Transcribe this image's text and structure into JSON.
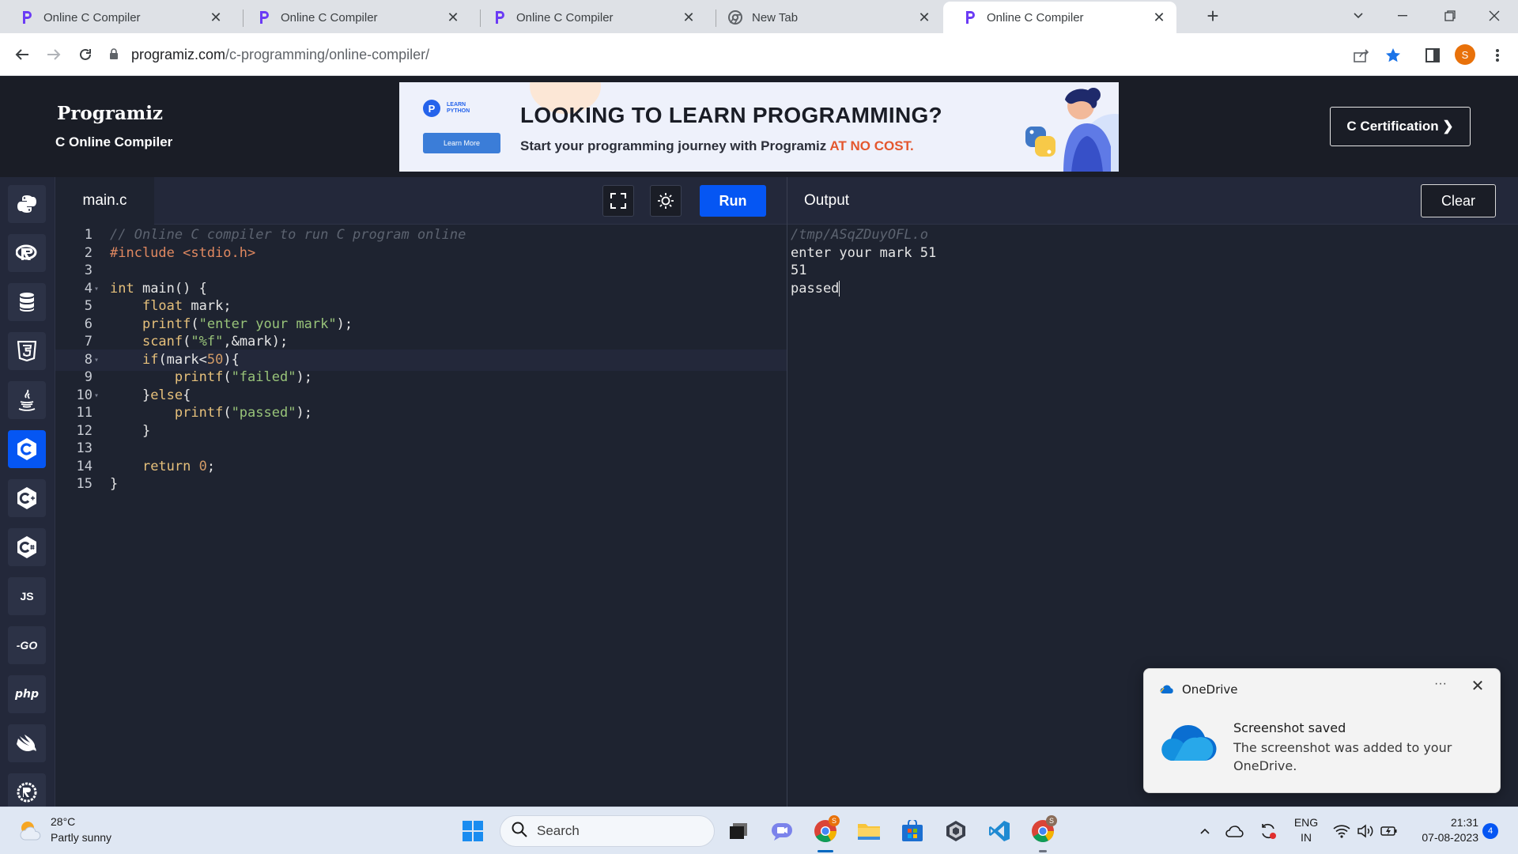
{
  "browser": {
    "tabs": [
      {
        "title": "Online C Compiler",
        "favicon": "programiz-icon",
        "active": false
      },
      {
        "title": "Online C Compiler",
        "favicon": "programiz-icon",
        "active": false
      },
      {
        "title": "Online C Compiler",
        "favicon": "programiz-icon",
        "active": false
      },
      {
        "title": "New Tab",
        "favicon": "chrome-icon",
        "active": false
      },
      {
        "title": "Online C Compiler",
        "favicon": "programiz-icon",
        "active": true
      }
    ],
    "url_domain": "programiz.com",
    "url_path": "/c-programming/online-compiler/",
    "profile_initial": "S"
  },
  "site": {
    "logo": "Programiz",
    "subtitle": "C Online Compiler",
    "banner": {
      "badge": "LEARN PYTHON",
      "learn_more": "Learn More",
      "headline": "LOOKING TO LEARN PROGRAMMING?",
      "tagline_prefix": "Start your programming journey with Programiz ",
      "tagline_highlight": "AT NO COST."
    },
    "cert_button": "C Certification ❯"
  },
  "rail": {
    "items": [
      {
        "name": "python",
        "glyph": ""
      },
      {
        "name": "r",
        "glyph": ""
      },
      {
        "name": "sql",
        "glyph": ""
      },
      {
        "name": "html",
        "glyph": ""
      },
      {
        "name": "java",
        "glyph": ""
      },
      {
        "name": "c",
        "glyph": "",
        "active": true
      },
      {
        "name": "cpp",
        "glyph": ""
      },
      {
        "name": "csharp",
        "glyph": ""
      },
      {
        "name": "js",
        "glyph": "JS"
      },
      {
        "name": "go",
        "glyph": "-GO"
      },
      {
        "name": "php",
        "glyph": "php"
      },
      {
        "name": "swift",
        "glyph": ""
      },
      {
        "name": "rust",
        "glyph": ""
      }
    ]
  },
  "editor": {
    "file_tab": "main.c",
    "run_label": "Run",
    "current_line": 8,
    "lines": [
      {
        "n": "1",
        "fold": "",
        "tokens": [
          [
            "cm",
            "// Online C compiler to run C program online"
          ]
        ]
      },
      {
        "n": "2",
        "fold": "",
        "tokens": [
          [
            "pre",
            "#include <stdio.h>"
          ]
        ]
      },
      {
        "n": "3",
        "fold": "",
        "tokens": []
      },
      {
        "n": "4",
        "fold": "▾",
        "tokens": [
          [
            "kw",
            "int"
          ],
          [
            "",
            " main() {"
          ]
        ]
      },
      {
        "n": "5",
        "fold": "",
        "tokens": [
          [
            "",
            "    "
          ],
          [
            "kw",
            "float"
          ],
          [
            "",
            " mark;"
          ]
        ]
      },
      {
        "n": "6",
        "fold": "",
        "tokens": [
          [
            "",
            "    "
          ],
          [
            "fn",
            "printf"
          ],
          [
            "",
            "("
          ],
          [
            "str",
            "\"enter your mark\""
          ],
          [
            "",
            ");"
          ]
        ]
      },
      {
        "n": "7",
        "fold": "",
        "tokens": [
          [
            "",
            "    "
          ],
          [
            "fn",
            "scanf"
          ],
          [
            "",
            "("
          ],
          [
            "str",
            "\"%f\""
          ],
          [
            "",
            ",&mark);"
          ]
        ]
      },
      {
        "n": "8",
        "fold": "▾",
        "tokens": [
          [
            "",
            "    "
          ],
          [
            "kw",
            "if"
          ],
          [
            "",
            "(mark<"
          ],
          [
            "num",
            "50"
          ],
          [
            "",
            "){"
          ]
        ]
      },
      {
        "n": "9",
        "fold": "",
        "tokens": [
          [
            "",
            "        "
          ],
          [
            "fn",
            "printf"
          ],
          [
            "",
            "("
          ],
          [
            "str",
            "\"failed\""
          ],
          [
            "",
            ");"
          ]
        ]
      },
      {
        "n": "10",
        "fold": "▾",
        "tokens": [
          [
            "",
            "    }"
          ],
          [
            "kw",
            "else"
          ],
          [
            "",
            "{"
          ]
        ]
      },
      {
        "n": "11",
        "fold": "",
        "tokens": [
          [
            "",
            "        "
          ],
          [
            "fn",
            "printf"
          ],
          [
            "",
            "("
          ],
          [
            "str",
            "\"passed\""
          ],
          [
            "",
            ");"
          ]
        ]
      },
      {
        "n": "12",
        "fold": "",
        "tokens": [
          [
            "",
            "    }"
          ]
        ]
      },
      {
        "n": "13",
        "fold": "",
        "tokens": []
      },
      {
        "n": "14",
        "fold": "",
        "tokens": [
          [
            "",
            "    "
          ],
          [
            "kw",
            "return"
          ],
          [
            "",
            " "
          ],
          [
            "num",
            "0"
          ],
          [
            "",
            ";"
          ]
        ]
      },
      {
        "n": "15",
        "fold": "",
        "tokens": [
          [
            "",
            "}"
          ]
        ]
      }
    ]
  },
  "output": {
    "title": "Output",
    "clear_label": "Clear",
    "lines": [
      "/tmp/ASqZDuyOFL.o",
      "enter your mark 51",
      "51",
      "passed"
    ]
  },
  "toast": {
    "app": "OneDrive",
    "more": "···",
    "title": "Screenshot saved",
    "body": "The screenshot was added to your OneDrive."
  },
  "taskbar": {
    "temp": "28°C",
    "condition": "Partly sunny",
    "search_placeholder": "Search",
    "lang_line1": "ENG",
    "lang_line2": "IN",
    "time": "21:31",
    "date": "07-08-2023",
    "notif_count": "4",
    "chrome_badge": "S"
  },
  "colors": {
    "accent": "#0556f3",
    "editor_bg": "#1e2330",
    "header_bg": "#1a1d26"
  }
}
